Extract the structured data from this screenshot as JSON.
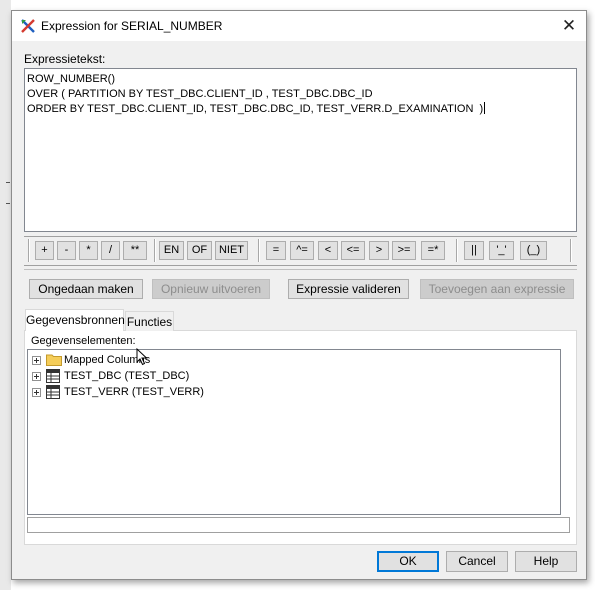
{
  "window": {
    "title": "Expression for SERIAL_NUMBER",
    "close_glyph": "✕",
    "app_icon": "tool-cross-icon"
  },
  "expression": {
    "label": "Expressietekst:",
    "lines": [
      "ROW_NUMBER()",
      "OVER ( PARTITION BY TEST_DBC.CLIENT_ID , TEST_DBC.DBC_ID",
      "ORDER BY TEST_DBC.CLIENT_ID, TEST_DBC.DBC_ID, TEST_VERR.D_EXAMINATION  )"
    ]
  },
  "operators": {
    "plus": "+",
    "minus": "-",
    "multiply": "*",
    "divide": "/",
    "power": "**",
    "and": "EN",
    "or": "OF",
    "not": "NIET",
    "eq": "=",
    "neq": "^=",
    "lt": "<",
    "lte": "<=",
    "gt": ">",
    "gte": ">=",
    "eq_star": "=*",
    "concat": "||",
    "quote": "'_'",
    "paren": "(_)"
  },
  "actions": {
    "undo": "Ongedaan maken",
    "redo": "Opnieuw uitvoeren",
    "validate": "Expressie valideren",
    "add": "Toevoegen aan expressie"
  },
  "tabs": {
    "sources": "Gegevensbronnen",
    "functions": "Functies"
  },
  "elements": {
    "label": "Gegevenselementen:",
    "items": [
      "Mapped Columns",
      "TEST_DBC (TEST_DBC)",
      "TEST_VERR (TEST_VERR)"
    ]
  },
  "footer": {
    "ok": "OK",
    "cancel": "Cancel",
    "help": "Help"
  },
  "colors": {
    "accent": "#0078d7",
    "folder": "#f5cd59",
    "dialog_bg": "#f0f0f0"
  }
}
